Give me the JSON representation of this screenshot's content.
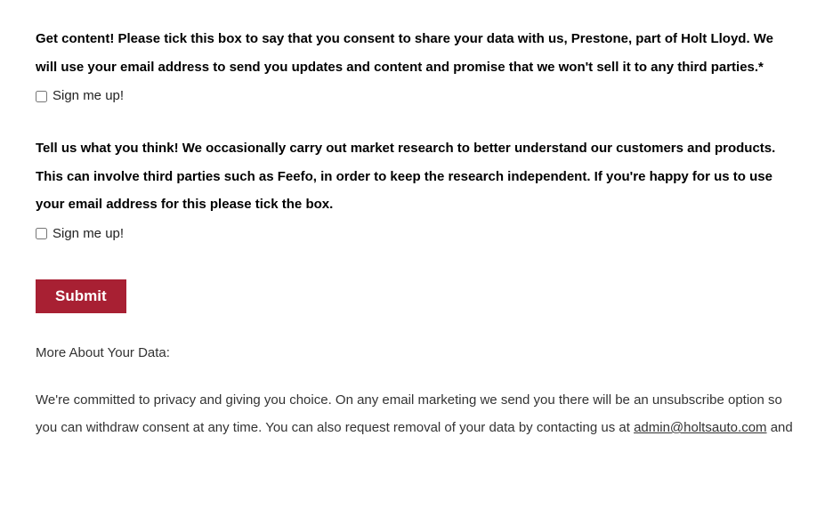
{
  "consent1": {
    "text": "Get content! Please tick this box to say that you consent to share your data with us, Prestone, part of Holt Lloyd. We will use your email address to send you updates and content and promise that we won't sell it to any third parties.*",
    "checkbox_label": "Sign me up!"
  },
  "consent2": {
    "text": "Tell us what you think! We occasionally carry out market research to better understand our customers and products. This can involve third parties such as Feefo, in order to keep the research independent. If you're happy for us to use your email address for this please tick the box.",
    "checkbox_label": "Sign me up!"
  },
  "submit_label": "Submit",
  "more": {
    "title": "More About Your Data:",
    "body_before_email": "We're committed to privacy and giving you choice. On any email marketing we send you there will be an unsubscribe option so you can withdraw consent at any time. You can also request removal of your data by contacting us at ",
    "email": "admin@holtsauto.com",
    "body_after_email": " and"
  }
}
